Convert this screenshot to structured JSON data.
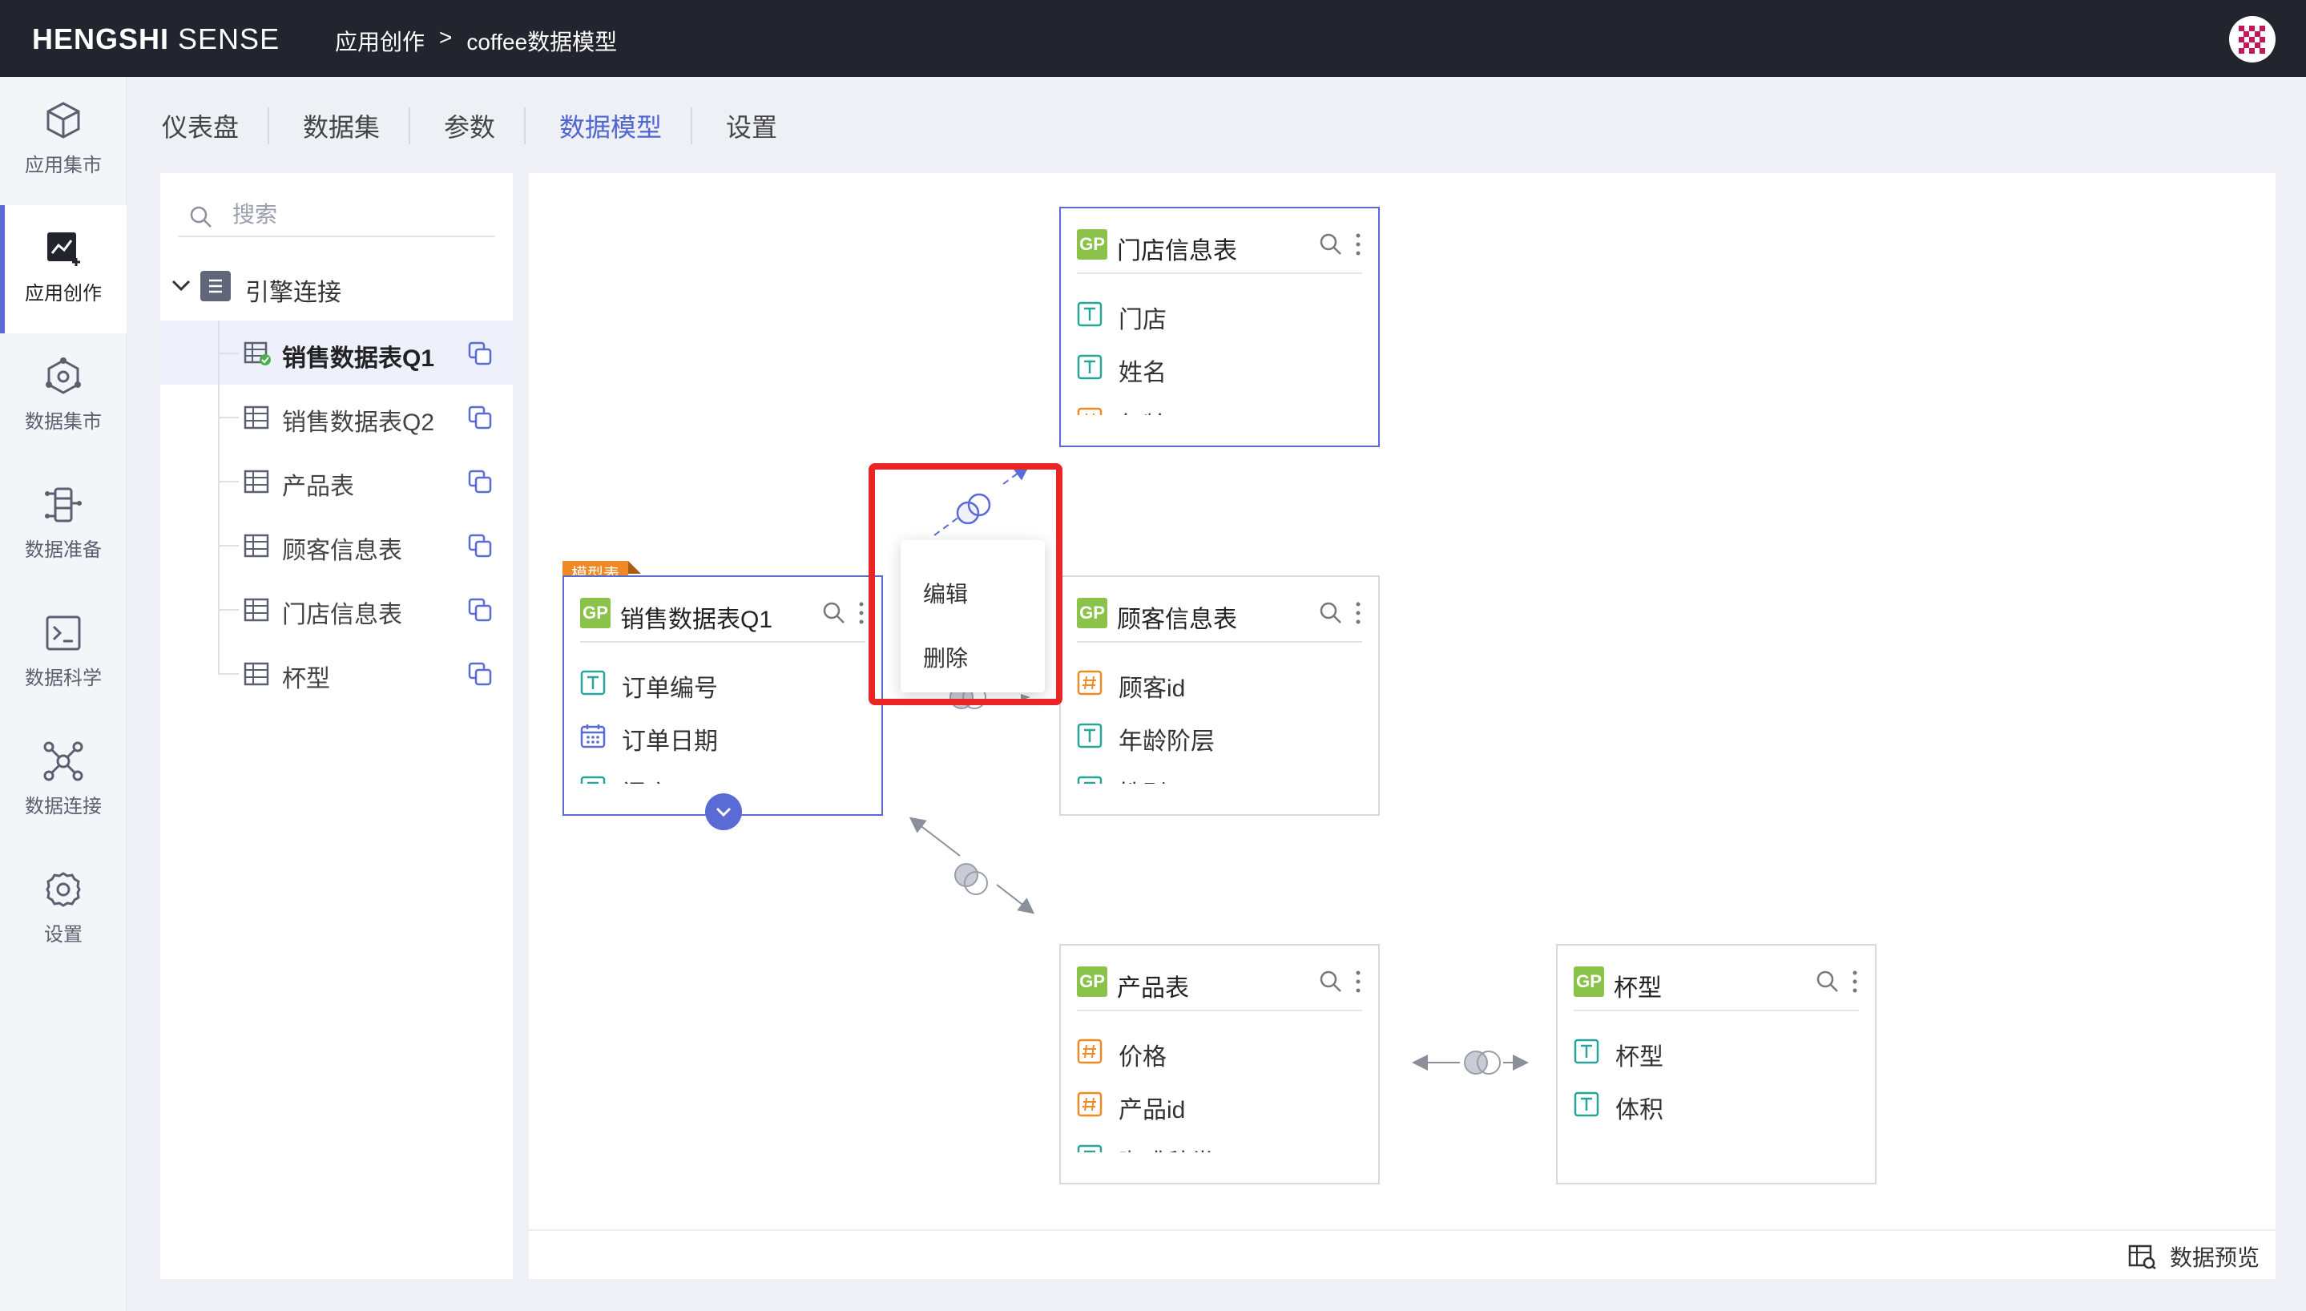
{
  "brand": {
    "bold": "HENGSHI",
    "light": " SENSE"
  },
  "breadcrumb": {
    "parent": "应用创作",
    "sep": ">",
    "current": "coffee数据模型"
  },
  "nav": [
    {
      "label": "应用集市",
      "icon": "cube-icon"
    },
    {
      "label": "应用创作",
      "icon": "chart-create-icon",
      "active": true
    },
    {
      "label": "数据集市",
      "icon": "hexagon-nodes-icon"
    },
    {
      "label": "数据准备",
      "icon": "data-prep-icon"
    },
    {
      "label": "数据科学",
      "icon": "terminal-icon"
    },
    {
      "label": "数据连接",
      "icon": "network-icon"
    },
    {
      "label": "设置",
      "icon": "gear-icon"
    }
  ],
  "tabs": [
    {
      "label": "仪表盘"
    },
    {
      "label": "数据集"
    },
    {
      "label": "参数"
    },
    {
      "label": "数据模型",
      "active": true
    },
    {
      "label": "设置"
    }
  ],
  "tree": {
    "search_placeholder": "搜索",
    "root_label": "引擎连接",
    "items": [
      {
        "label": "销售数据表Q1",
        "active": true
      },
      {
        "label": "销售数据表Q2"
      },
      {
        "label": "产品表"
      },
      {
        "label": "顾客信息表"
      },
      {
        "label": "门店信息表"
      },
      {
        "label": "杯型"
      }
    ]
  },
  "model": {
    "badge": "模型表",
    "gp_label": "GP",
    "tables": [
      {
        "title": "销售数据表Q1",
        "fields": [
          {
            "name": "订单编号",
            "type": "text"
          },
          {
            "name": "订单日期",
            "type": "date"
          },
          {
            "name": "门店",
            "type": "text"
          }
        ]
      },
      {
        "title": "门店信息表",
        "fields": [
          {
            "name": "门店",
            "type": "text"
          },
          {
            "name": "姓名",
            "type": "text"
          },
          {
            "name": "年龄",
            "type": "number"
          }
        ]
      },
      {
        "title": "顾客信息表",
        "fields": [
          {
            "name": "顾客id",
            "type": "number"
          },
          {
            "name": "年龄阶层",
            "type": "text"
          },
          {
            "name": "性别",
            "type": "text"
          }
        ]
      },
      {
        "title": "产品表",
        "fields": [
          {
            "name": "价格",
            "type": "number"
          },
          {
            "name": "产品id",
            "type": "number"
          },
          {
            "name": "咖啡种类",
            "type": "text"
          }
        ]
      },
      {
        "title": "杯型",
        "fields": [
          {
            "name": "杯型",
            "type": "text"
          },
          {
            "name": "体积",
            "type": "text"
          }
        ]
      }
    ]
  },
  "context_menu": {
    "edit": "编辑",
    "delete": "删除"
  },
  "footer": {
    "preview_label": "数据预览"
  },
  "colors": {
    "accent": "#5b6bd6",
    "topbar": "#22252e",
    "highlight": "#ea2525",
    "gp": "#8bc34a",
    "badge": "#f08a24"
  }
}
